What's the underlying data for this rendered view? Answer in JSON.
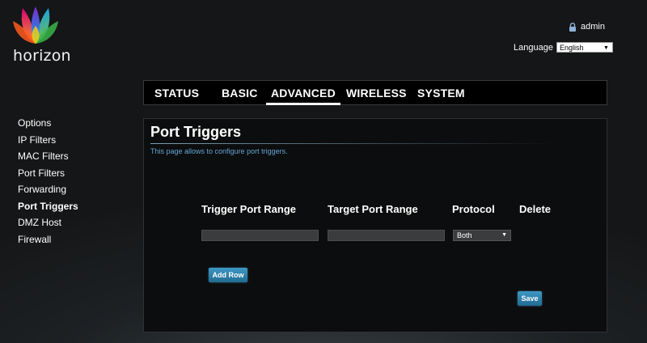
{
  "brand": {
    "name": "horizon"
  },
  "header": {
    "username": "admin",
    "language_label": "Language",
    "language_value": "English"
  },
  "tabs": [
    {
      "label": "STATUS",
      "active": false
    },
    {
      "label": "BASIC",
      "active": false
    },
    {
      "label": "ADVANCED",
      "active": true
    },
    {
      "label": "WIRELESS",
      "active": false
    },
    {
      "label": "SYSTEM",
      "active": false
    }
  ],
  "sidebar": {
    "items": [
      {
        "label": "Options",
        "active": false
      },
      {
        "label": "IP Filters",
        "active": false
      },
      {
        "label": "MAC Filters",
        "active": false
      },
      {
        "label": "Port Filters",
        "active": false
      },
      {
        "label": "Forwarding",
        "active": false
      },
      {
        "label": "Port Triggers",
        "active": true
      },
      {
        "label": "DMZ Host",
        "active": false
      },
      {
        "label": "Firewall",
        "active": false
      }
    ]
  },
  "main": {
    "title": "Port Triggers",
    "description": "This page allows to configure port triggers.",
    "columns": {
      "trigger": "Trigger Port Range",
      "target": "Target Port Range",
      "protocol": "Protocol",
      "delete": "Delete"
    },
    "row": {
      "trigger_value": "",
      "target_value": "",
      "protocol_value": "Both"
    },
    "add_row_label": "Add Row",
    "save_label": "Save"
  },
  "colors": {
    "accent": "#2a7fa8",
    "link": "#63a7d6",
    "tab_bar": "#000000"
  }
}
